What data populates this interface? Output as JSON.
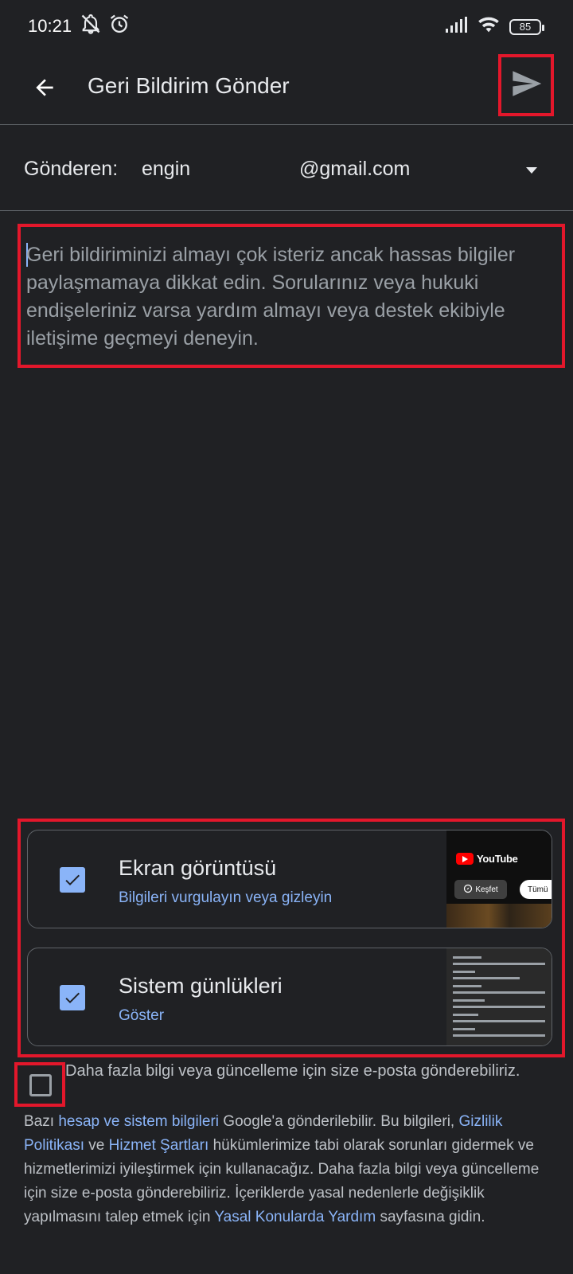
{
  "status_bar": {
    "time": "10:21",
    "left_icons": [
      "notifications-muted-icon",
      "alarm-icon"
    ],
    "right_icons": [
      "signal-icon",
      "wifi-icon",
      "battery-icon"
    ],
    "battery_level": "85"
  },
  "app_bar": {
    "title": "Geri Bildirim Gönder",
    "back_icon": "arrow-back-icon",
    "send_icon": "send-icon"
  },
  "sender": {
    "label": "Gönderen:",
    "name": "engin",
    "email": "@gmail.com",
    "dropdown_icon": "dropdown-arrow-icon"
  },
  "feedback": {
    "placeholder": "Geri bildiriminizi almayı çok isteriz ancak hassas bilgiler paylaşmamaya dikkat edin. Sorularınız veya hukuki endişeleriniz varsa yardım almayı veya destek ekibiyle iletişime geçmeyi deneyin."
  },
  "attachments": {
    "screenshot": {
      "checked": true,
      "title": "Ekran görüntüsü",
      "subtitle": "Bilgileri vurgulayın veya gizleyin",
      "thumb": {
        "brand": "YouTube",
        "chip_explore": "Keşfet",
        "chip_all": "Tümü"
      }
    },
    "system_logs": {
      "checked": true,
      "title": "Sistem günlükleri",
      "subtitle": "Göster"
    }
  },
  "email_opt_in": {
    "checked": false,
    "label": "Daha fazla bilgi veya güncelleme için size e-posta gönderebiliriz."
  },
  "legal": {
    "t1": "Bazı ",
    "link_account": "hesap ve sistem bilgileri",
    "t2": " Google'a gönderilebilir. Bu bilgileri, ",
    "link_privacy": "Gizlilik Politikası",
    "t3": " ve ",
    "link_terms": "Hizmet Şartları",
    "t4": " hükümlerimize tabi olarak sorunları gidermek ve hizmetlerimizi iyileştirmek için kullanacağız. Daha fazla bilgi veya güncelleme için size e-posta gönderebiliriz. İçeriklerde yasal nedenlerle değişiklik yapılmasını talep etmek için ",
    "link_legal": "Yasal Konularda Yardım",
    "t5": " sayfasına gidin."
  },
  "colors": {
    "background": "#202124",
    "accent": "#8ab4f8",
    "highlight": "#e3172b"
  }
}
